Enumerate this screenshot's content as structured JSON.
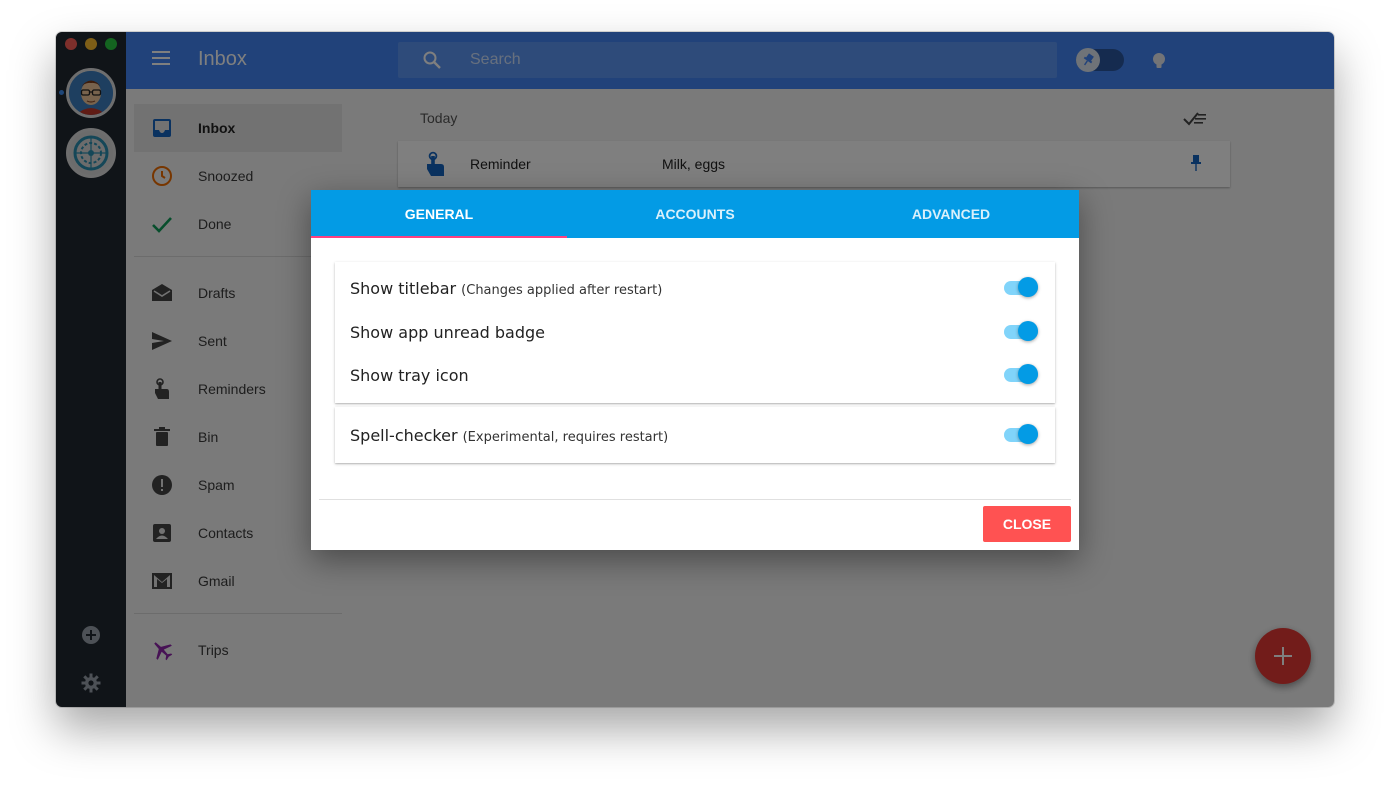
{
  "window": {
    "traffic_lights": [
      "close",
      "minimize",
      "zoom"
    ]
  },
  "accounts": [
    {
      "name": "account-avatar-1",
      "icon": "avatar"
    },
    {
      "name": "account-avatar-2",
      "icon": "service-logo"
    }
  ],
  "rail_actions": {
    "add_icon": "add-circle-icon",
    "settings_icon": "gear-icon"
  },
  "header": {
    "title": "Inbox",
    "search_placeholder": "Search",
    "colors": {
      "bar": "#4285f4"
    }
  },
  "nav": {
    "items": [
      {
        "label": "Inbox",
        "icon": "inbox-icon",
        "active": true
      },
      {
        "label": "Snoozed",
        "icon": "clock-icon"
      },
      {
        "label": "Done",
        "icon": "check-icon"
      },
      {
        "label": "Drafts",
        "icon": "drafts-icon"
      },
      {
        "label": "Sent",
        "icon": "send-icon"
      },
      {
        "label": "Reminders",
        "icon": "reminder-icon"
      },
      {
        "label": "Bin",
        "icon": "trash-icon"
      },
      {
        "label": "Spam",
        "icon": "spam-icon"
      },
      {
        "label": "Contacts",
        "icon": "contacts-icon"
      },
      {
        "label": "Gmail",
        "icon": "gmail-icon"
      },
      {
        "label": "Trips",
        "icon": "plane-icon"
      }
    ]
  },
  "inbox": {
    "section_label": "Today",
    "rows": [
      {
        "sender": "Reminder",
        "subject": "Milk, eggs",
        "pinned": true
      }
    ]
  },
  "dialog": {
    "tabs": [
      {
        "label": "General",
        "active": true
      },
      {
        "label": "Accounts",
        "active": false
      },
      {
        "label": "Advanced",
        "active": false
      }
    ],
    "settings": [
      {
        "label": "Show titlebar",
        "note": "(Changes applied after restart)",
        "enabled": true
      },
      {
        "label": "Show app unread badge",
        "note": "",
        "enabled": true
      },
      {
        "label": "Show tray icon",
        "note": "",
        "enabled": true
      },
      {
        "label": "Spell-checker",
        "note": "(Experimental, requires restart)",
        "enabled": true
      }
    ],
    "close_label": "Close",
    "colors": {
      "tab_bar": "#039be5",
      "close_button": "#ff5252",
      "toggle_on": "#039be5"
    }
  },
  "fab": {
    "icon": "plus-icon",
    "color": "#e53935"
  }
}
